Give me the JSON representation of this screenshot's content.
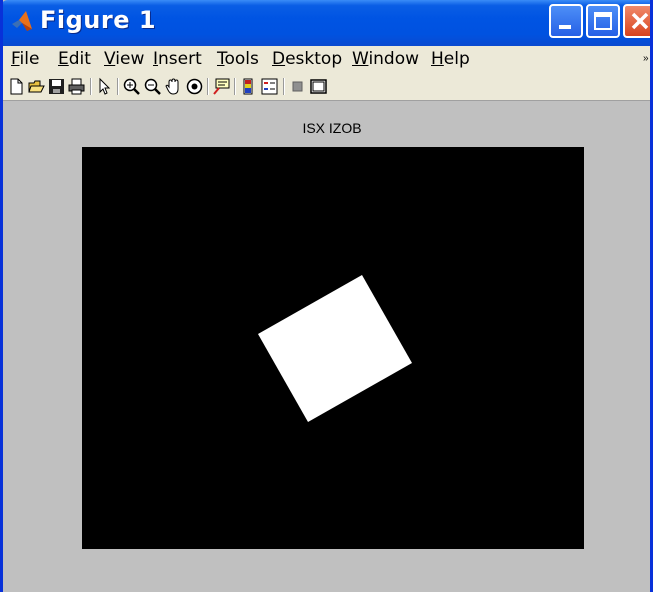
{
  "window": {
    "title": "Figure 1",
    "app_icon": "matlab-logo-icon"
  },
  "menubar": {
    "items": [
      {
        "label": "File",
        "accel": "F",
        "rest": "ile"
      },
      {
        "label": "Edit",
        "accel": "E",
        "rest": "dit"
      },
      {
        "label": "View",
        "accel": "V",
        "rest": "iew"
      },
      {
        "label": "Insert",
        "accel": "I",
        "rest": "nsert"
      },
      {
        "label": "Tools",
        "accel": "T",
        "rest": "ools"
      },
      {
        "label": "Desktop",
        "accel": "D",
        "rest": "esktop"
      },
      {
        "label": "Window",
        "accel": "W",
        "rest": "indow"
      },
      {
        "label": "Help",
        "accel": "H",
        "rest": "elp"
      }
    ]
  },
  "toolbar": {
    "tools": [
      "new-figure-icon",
      "open-file-icon",
      "save-icon",
      "print-icon",
      "edit-plot-arrow-icon",
      "zoom-in-icon",
      "zoom-out-icon",
      "pan-hand-icon",
      "rotate-3d-icon",
      "data-cursor-icon",
      "insert-colorbar-icon",
      "insert-legend-icon",
      "hide-plot-tools-icon",
      "show-plot-tools-icon"
    ]
  },
  "figure": {
    "title": "ISX IZOB",
    "background": "#c0c0c0",
    "axes_background": "#000000",
    "shape_color": "#ffffff",
    "shape": "rotated-square"
  }
}
